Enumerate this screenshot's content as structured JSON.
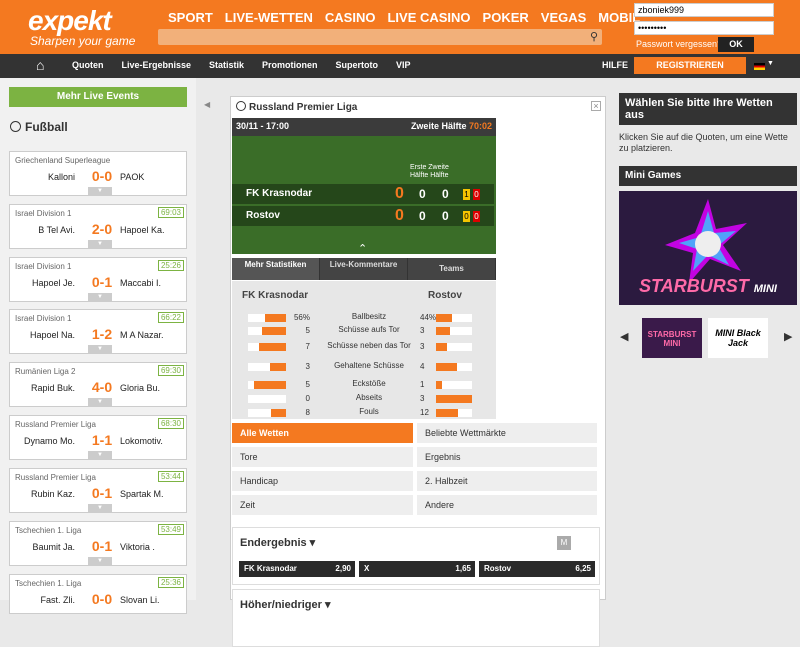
{
  "brand": {
    "logo": "expekt",
    "tagline": "Sharpen your game"
  },
  "mainnav": [
    "SPORT",
    "LIVE-WETTEN",
    "CASINO",
    "LIVE CASINO",
    "POKER",
    "VEGAS",
    "MOBIL"
  ],
  "login": {
    "username": "zboniek999",
    "password": "•••••••••",
    "forgot": "Passwort vergessen?",
    "ok": "OK"
  },
  "subnav": [
    "Quoten",
    "Live-Ergebnisse",
    "Statistik",
    "Promotionen",
    "Supertoto",
    "VIP"
  ],
  "hilfe": "HILFE",
  "register": "REGISTRIEREN",
  "left": {
    "more": "Mehr Live Events",
    "sport": "Fußball",
    "matches": [
      {
        "league": "Griechenland Superleague",
        "time": "",
        "home": "Kalloni",
        "score": "0-0",
        "away": "PAOK"
      },
      {
        "league": "Israel Division 1",
        "time": "69:03",
        "home": "B Tel Avi.",
        "score": "2-0",
        "away": "Hapoel Ka."
      },
      {
        "league": "Israel Division 1",
        "time": "25:26",
        "home": "Hapoel Je.",
        "score": "0-1",
        "away": "Maccabi I."
      },
      {
        "league": "Israel Division 1",
        "time": "66:22",
        "home": "Hapoel Na.",
        "score": "1-2",
        "away": "M A Nazar."
      },
      {
        "league": "Rumänien Liga 2",
        "time": "69:30",
        "home": "Rapid Buk.",
        "score": "4-0",
        "away": "Gloria Bu."
      },
      {
        "league": "Russland Premier Liga",
        "time": "68:30",
        "home": "Dynamo Mo.",
        "score": "1-1",
        "away": "Lokomotiv."
      },
      {
        "league": "Russland Premier Liga",
        "time": "53:44",
        "home": "Rubin Kaz.",
        "score": "0-1",
        "away": "Spartak M."
      },
      {
        "league": "Tschechien 1. Liga",
        "time": "53:49",
        "home": "Baumit Ja.",
        "score": "0-1",
        "away": "Viktoria ."
      },
      {
        "league": "Tschechien 1. Liga",
        "time": "25:36",
        "home": "Fast. Zli.",
        "score": "0-0",
        "away": "Slovan Li."
      }
    ]
  },
  "event": {
    "league": "Russland Premier Liga",
    "date": "30/11 - 17:00",
    "half": "Zweite Hälfte",
    "clock": "70:02",
    "ht_header": "Erste Zweite\nHälfte Hälfte",
    "home": {
      "name": "FK Krasnodar",
      "score": "0",
      "h1": "0",
      "h2": "0",
      "yellow": "1",
      "red": "0"
    },
    "away": {
      "name": "Rostov",
      "score": "0",
      "h1": "0",
      "h2": "0",
      "yellow": "0",
      "red": "0"
    },
    "tabs": [
      "Mehr Statistiken",
      "Live-Kommentare",
      "Teams"
    ],
    "stats": [
      {
        "label": "Ballbesitz",
        "home": "56%",
        "away": "44%",
        "hp": 0.56,
        "ap": 0.44
      },
      {
        "label": "Schüsse aufs Tor",
        "home": "5",
        "away": "3",
        "hp": 0.62,
        "ap": 0.38
      },
      {
        "label": "Schüsse neben das Tor",
        "home": "7",
        "away": "3",
        "hp": 0.7,
        "ap": 0.3
      },
      {
        "label": "Gehaltene Schüsse",
        "home": "3",
        "away": "4",
        "hp": 0.43,
        "ap": 0.57
      },
      {
        "label": "Eckstöße",
        "home": "5",
        "away": "1",
        "hp": 0.83,
        "ap": 0.17
      },
      {
        "label": "Abseits",
        "home": "0",
        "away": "3",
        "hp": 0,
        "ap": 1
      },
      {
        "label": "Fouls",
        "home": "8",
        "away": "12",
        "hp": 0.4,
        "ap": 0.6
      }
    ],
    "filters": [
      "Alle Wetten",
      "Beliebte Wettmärkte",
      "Tore",
      "Ergebnis",
      "Handicap",
      "2. Halbzeit",
      "Zeit",
      "Andere"
    ],
    "market1": {
      "title": "Endergebnis ▾",
      "badge": "M",
      "odds": [
        {
          "name": "FK Krasnodar",
          "val": "2,90"
        },
        {
          "name": "X",
          "val": "1,65"
        },
        {
          "name": "Rostov",
          "val": "6,25"
        }
      ]
    },
    "market2": {
      "title": "Höher/niedriger ▾"
    }
  },
  "right": {
    "title": "Wählen Sie bitte Ihre Wetten aus",
    "hint": "Klicken Sie auf die Quoten, um eine Wette zu platzieren.",
    "mini": "Mini Games",
    "game": "STARBURST",
    "game_suffix": "MINI",
    "thumb1": "STARBURST MINI",
    "thumb2": "MINI Black Jack"
  },
  "colors": {
    "accent": "#f47920",
    "green": "#7cb342",
    "dark": "#333333"
  }
}
